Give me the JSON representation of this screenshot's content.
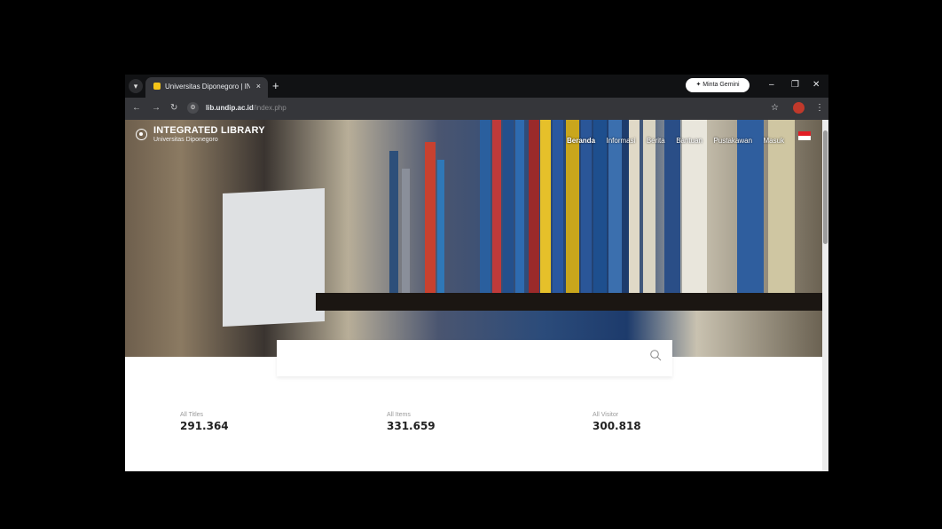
{
  "browser": {
    "tab_title": "Universitas Diponegoro | INTE",
    "tab_close": "×",
    "new_tab": "+",
    "gemini_label": "Minta Gemini",
    "url_host": "lib.undip.ac.id",
    "url_path": "/index.php",
    "controls": {
      "minimize": "–",
      "restore": "❐",
      "close": "✕"
    }
  },
  "site": {
    "title": "INTEGRATED LIBRARY",
    "subtitle": "Universitas Diponegoro",
    "nav": [
      "Beranda",
      "Informasi",
      "Berita",
      "Bantuan",
      "Pustakawan",
      "Masuk"
    ],
    "active_nav": "Beranda"
  },
  "search": {
    "placeholder": ""
  },
  "stats": [
    {
      "label": "All Titles",
      "value": "291.364"
    },
    {
      "label": "All Items",
      "value": "331.659"
    },
    {
      "label": "All Visitor",
      "value": "300.818"
    }
  ],
  "colors": {
    "accent": "#1a73e8",
    "flag_red": "#e11d24"
  }
}
